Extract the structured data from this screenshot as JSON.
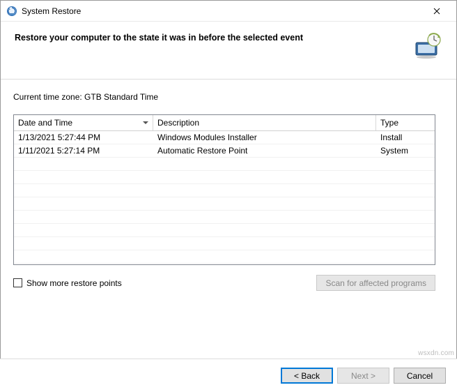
{
  "window": {
    "title": "System Restore"
  },
  "header": {
    "instruction": "Restore your computer to the state it was in before the selected event"
  },
  "timezone": {
    "label": "Current time zone: GTB Standard Time"
  },
  "table": {
    "columns": {
      "date": "Date and Time",
      "desc": "Description",
      "type": "Type"
    },
    "rows": [
      {
        "date": "1/13/2021 5:27:44 PM",
        "desc": "Windows Modules Installer",
        "type": "Install"
      },
      {
        "date": "1/11/2021 5:27:14 PM",
        "desc": "Automatic Restore Point",
        "type": "System"
      }
    ]
  },
  "checkbox": {
    "label": "Show more restore points"
  },
  "buttons": {
    "scan": "Scan for affected programs",
    "back": "< Back",
    "next": "Next >",
    "cancel": "Cancel"
  },
  "watermark": "wsxdn.com"
}
